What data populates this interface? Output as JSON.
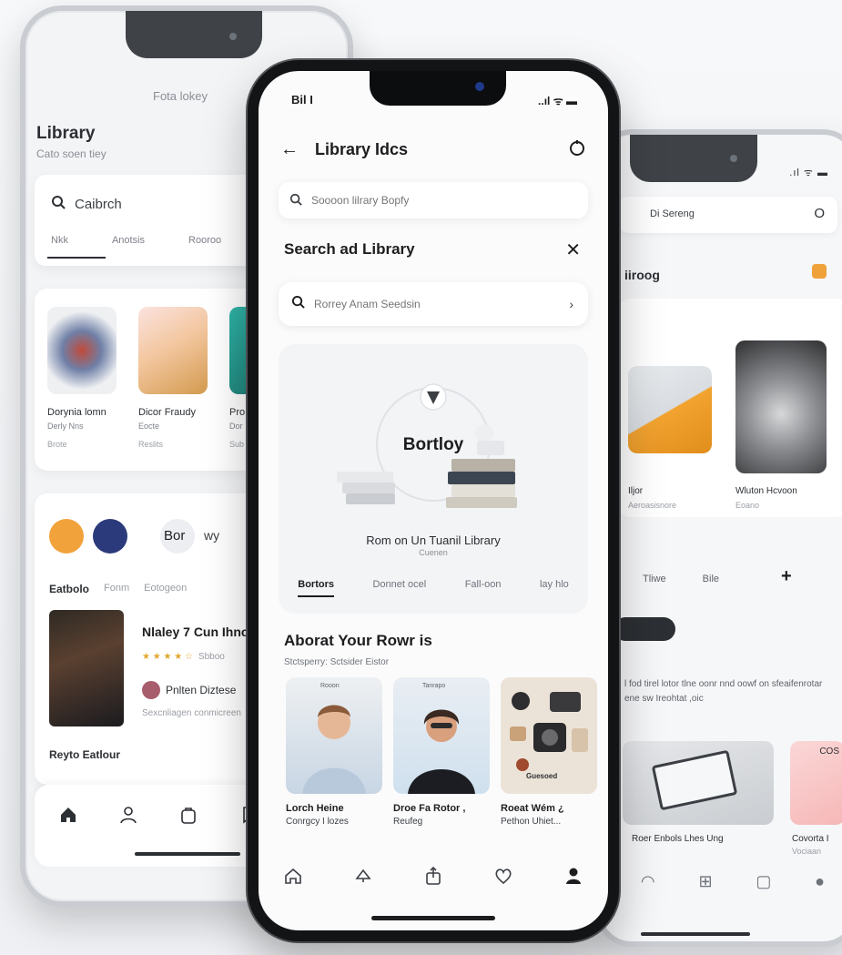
{
  "left_phone": {
    "faint_header": "Fota lokey",
    "title": "Library",
    "subtitle": "Cato soen tiey",
    "search_label": "Caibrch",
    "tabs": [
      "Nkk",
      "Anotsis",
      "Rooroo"
    ],
    "cards": [
      {
        "title": "Dorynia lomn",
        "sub": "Derly Nns",
        "meta": "Brote"
      },
      {
        "title": "Dicor Fraudy",
        "sub": "Eocte",
        "meta": "Reslits"
      },
      {
        "title": "Pro",
        "sub": "Dor",
        "meta": "Sub"
      }
    ],
    "profile_name_badge": "Bor",
    "profile_name_rest": "wy",
    "sections": [
      "Eatbolo",
      "Fonm",
      "Eotogeon"
    ],
    "book_title": "Nlaley 7 Cun Ihnch",
    "book_rating_text": "Sbboo",
    "book_author": "Pnlten Diztese",
    "book_desc": "Sexcnliagen conmicreen",
    "bottom_section": "Reyto Eatlour",
    "colors": {
      "avatar1": "#f2a23b",
      "avatar2": "#2b3a7a"
    }
  },
  "center_phone": {
    "time": "Bil I",
    "status": "..ıl ᯤ ▬",
    "header_title": "Library Idcs",
    "search1_placeholder": "Soooon lilrary Bopfy",
    "panel_title": "Search ad Library",
    "search2_placeholder": "Rorrey Anam Seedsin",
    "hero_name": "Bortloy",
    "hero_subtitle": "Rom on Un Tuanil Library",
    "hero_subtitle2": "Cuenen",
    "tabs": [
      "Bortors",
      "Donnet ocel",
      "Fall-oon",
      "lay hlo"
    ],
    "section_title": "Aborat Your Rowr is",
    "section_subtitle": "Stctsperry: Sctsider Eistor",
    "cards": [
      {
        "line1": "Lorch Heine",
        "line2": "Conrgcy I lozes",
        "banner": "Rooon"
      },
      {
        "line1": "Droe Fa Rotor ,",
        "line2": "Reufeg",
        "banner": "Tanrapo"
      },
      {
        "line1": "Roeat Wém ¿",
        "line2": "Pethon Uhiet...",
        "banner": "Guesoed"
      }
    ],
    "nav": [
      "home-icon",
      "search-icon",
      "share-icon",
      "heart-icon",
      "user-icon"
    ]
  },
  "right_phone": {
    "status": ".ıl ᯤ ▬",
    "topbar_label": "Di Sereng",
    "heading": "iiroog",
    "card_caption1": "Iljor",
    "card_caption1b": "Aeroasisnore",
    "card_caption2": "Wluton Hcvoon",
    "card_caption2b": "Eoano",
    "tabs": [
      "Tliwe",
      "Bile"
    ],
    "description": "l fod tirel lotor tlne oonr nnd oowf on sfeaifenrotar ene sw Ireohtat ,oic",
    "card_caption3": "Roer Enbols Lhes Ung",
    "card_caption4": "Covorta I",
    "card_caption4b": "Vociaan",
    "card_badge": "COS"
  }
}
